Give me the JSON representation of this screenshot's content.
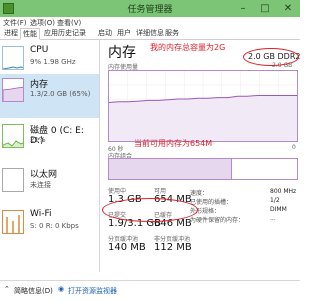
{
  "window": {
    "title": "任务管理器",
    "minimize": "–",
    "maximize": "□",
    "close": "✕"
  },
  "menu": [
    "文件(F)",
    "选项(O)",
    "查看(V)"
  ],
  "tabs": [
    "进程",
    "性能",
    "应用历史记录",
    "启动",
    "用户",
    "详细信息",
    "服务"
  ],
  "active_tab": 1,
  "sidebar": [
    {
      "title": "CPU",
      "lines": [
        "9% 1.98 GHz"
      ]
    },
    {
      "title": "内存",
      "lines": [
        "1.3/2.0 GB (65%)"
      ]
    },
    {
      "title": "磁盘 0 (C: E: D:)",
      "lines": [
        "21%"
      ]
    },
    {
      "title": "以太网",
      "lines": [
        "未连接"
      ]
    },
    {
      "title": "Wi-Fi",
      "lines": [
        "S: 0 R: 0 Kbps"
      ]
    }
  ],
  "memory": {
    "heading": "内存",
    "total": "2.0 GB DDR2",
    "usage_label": "内存使用量",
    "graph_max": "2.0 GB",
    "graph_min": "60 秒",
    "graph_zero": "0",
    "comp_label": "内存组合",
    "in_use_label": "使用中",
    "in_use": "1.3 GB",
    "available_label": "可用",
    "available": "654 MB",
    "committed_label": "已提交",
    "committed": "1.9/3.1 GB",
    "cached_label": "已缓存",
    "cached": "646 MB",
    "paged_label": "分页缓冲池",
    "paged": "140 MB",
    "nonpaged_label": "非分页缓冲池",
    "nonpaged": "112 MB",
    "usage_series": [
      0.55,
      0.56,
      0.56,
      0.57,
      0.58,
      0.58,
      0.59,
      0.6,
      0.6,
      0.61,
      0.61,
      0.62,
      0.62,
      0.64,
      0.64,
      0.65,
      0.65,
      0.65,
      0.65,
      0.65
    ],
    "usage_fraction": 0.65
  },
  "specs": [
    {
      "k": "速度：",
      "v": "800 MHz"
    },
    {
      "k": "已使用的插槽：",
      "v": "1/2"
    },
    {
      "k": "外形规格：",
      "v": "DIMM"
    },
    {
      "k": "为硬件保留的内存：",
      "v": "..."
    }
  ],
  "annotations": {
    "total_note": "我的内存总容量为2G",
    "avail_note": "当前可用内存为654M"
  },
  "bottom": {
    "less": "简略信息(D)",
    "open": "打开资源监视器"
  },
  "colors": {
    "accent": "#b58ac9",
    "annot": "#e0202a",
    "title": "#7cc576"
  }
}
